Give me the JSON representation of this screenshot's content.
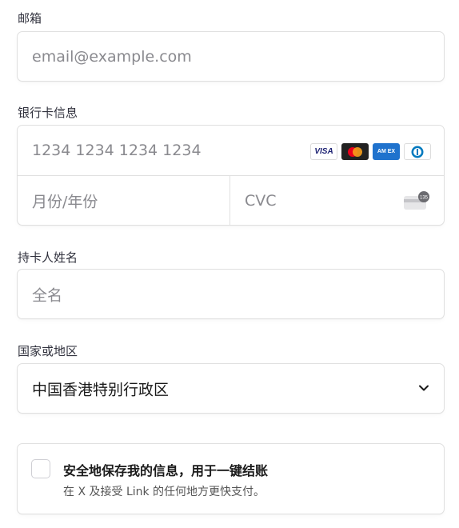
{
  "email": {
    "label": "邮箱",
    "placeholder": "email@example.com"
  },
  "card": {
    "label": "银行卡信息",
    "number_placeholder": "1234 1234 1234 1234",
    "expiry_placeholder": "月份/年份",
    "cvc_placeholder": "CVC",
    "brands": [
      "visa",
      "mastercard",
      "amex",
      "diners"
    ],
    "visa_text": "VISA",
    "amex_text": "AM EX",
    "cvc_icon_text": "135"
  },
  "cardholder": {
    "label": "持卡人姓名",
    "placeholder": "全名"
  },
  "country": {
    "label": "国家或地区",
    "value": "中国香港特别行政区"
  },
  "save_info": {
    "title": "安全地保存我的信息，用于一键结账",
    "subtitle": "在 X 及接受 Link 的任何地方更快支付。",
    "checked": false
  },
  "colors": {
    "border": "#e0e0e0",
    "placeholder": "#8a8a8f",
    "label": "#30313d",
    "mastercard_red": "#eb001b",
    "mastercard_orange": "#f79e1b",
    "amex_blue": "#1f72cd"
  }
}
